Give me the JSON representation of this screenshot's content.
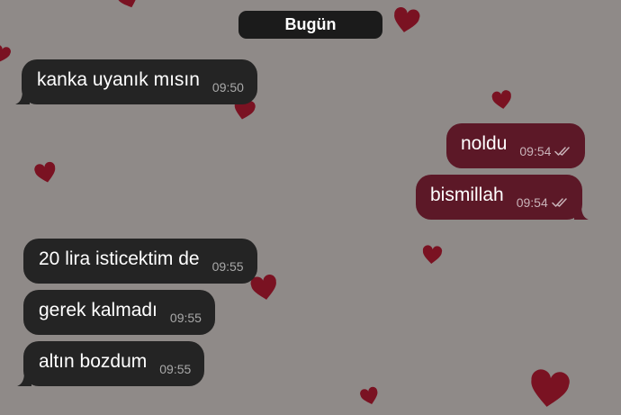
{
  "chat": {
    "date_label": "Bugün",
    "messages": [
      {
        "text": "kanka uyanık mısın",
        "time": "09:50",
        "direction": "incoming"
      },
      {
        "text": "noldu",
        "time": "09:54",
        "direction": "outgoing",
        "status_icon": "double-check-icon"
      },
      {
        "text": "bismillah",
        "time": "09:54",
        "direction": "outgoing",
        "status_icon": "double-check-icon"
      },
      {
        "text": "20 lira isticektim de",
        "time": "09:55",
        "direction": "incoming"
      },
      {
        "text": "gerek kalmadı",
        "time": "09:55",
        "direction": "incoming"
      },
      {
        "text": "altın bozdum",
        "time": "09:55",
        "direction": "incoming"
      }
    ]
  },
  "colors": {
    "wallpaper": "#8f8a88",
    "heart": "#7a1222",
    "incoming_bubble": "#242424",
    "outgoing_bubble": "#5c1827",
    "date_pill": "#1b1b1b"
  }
}
